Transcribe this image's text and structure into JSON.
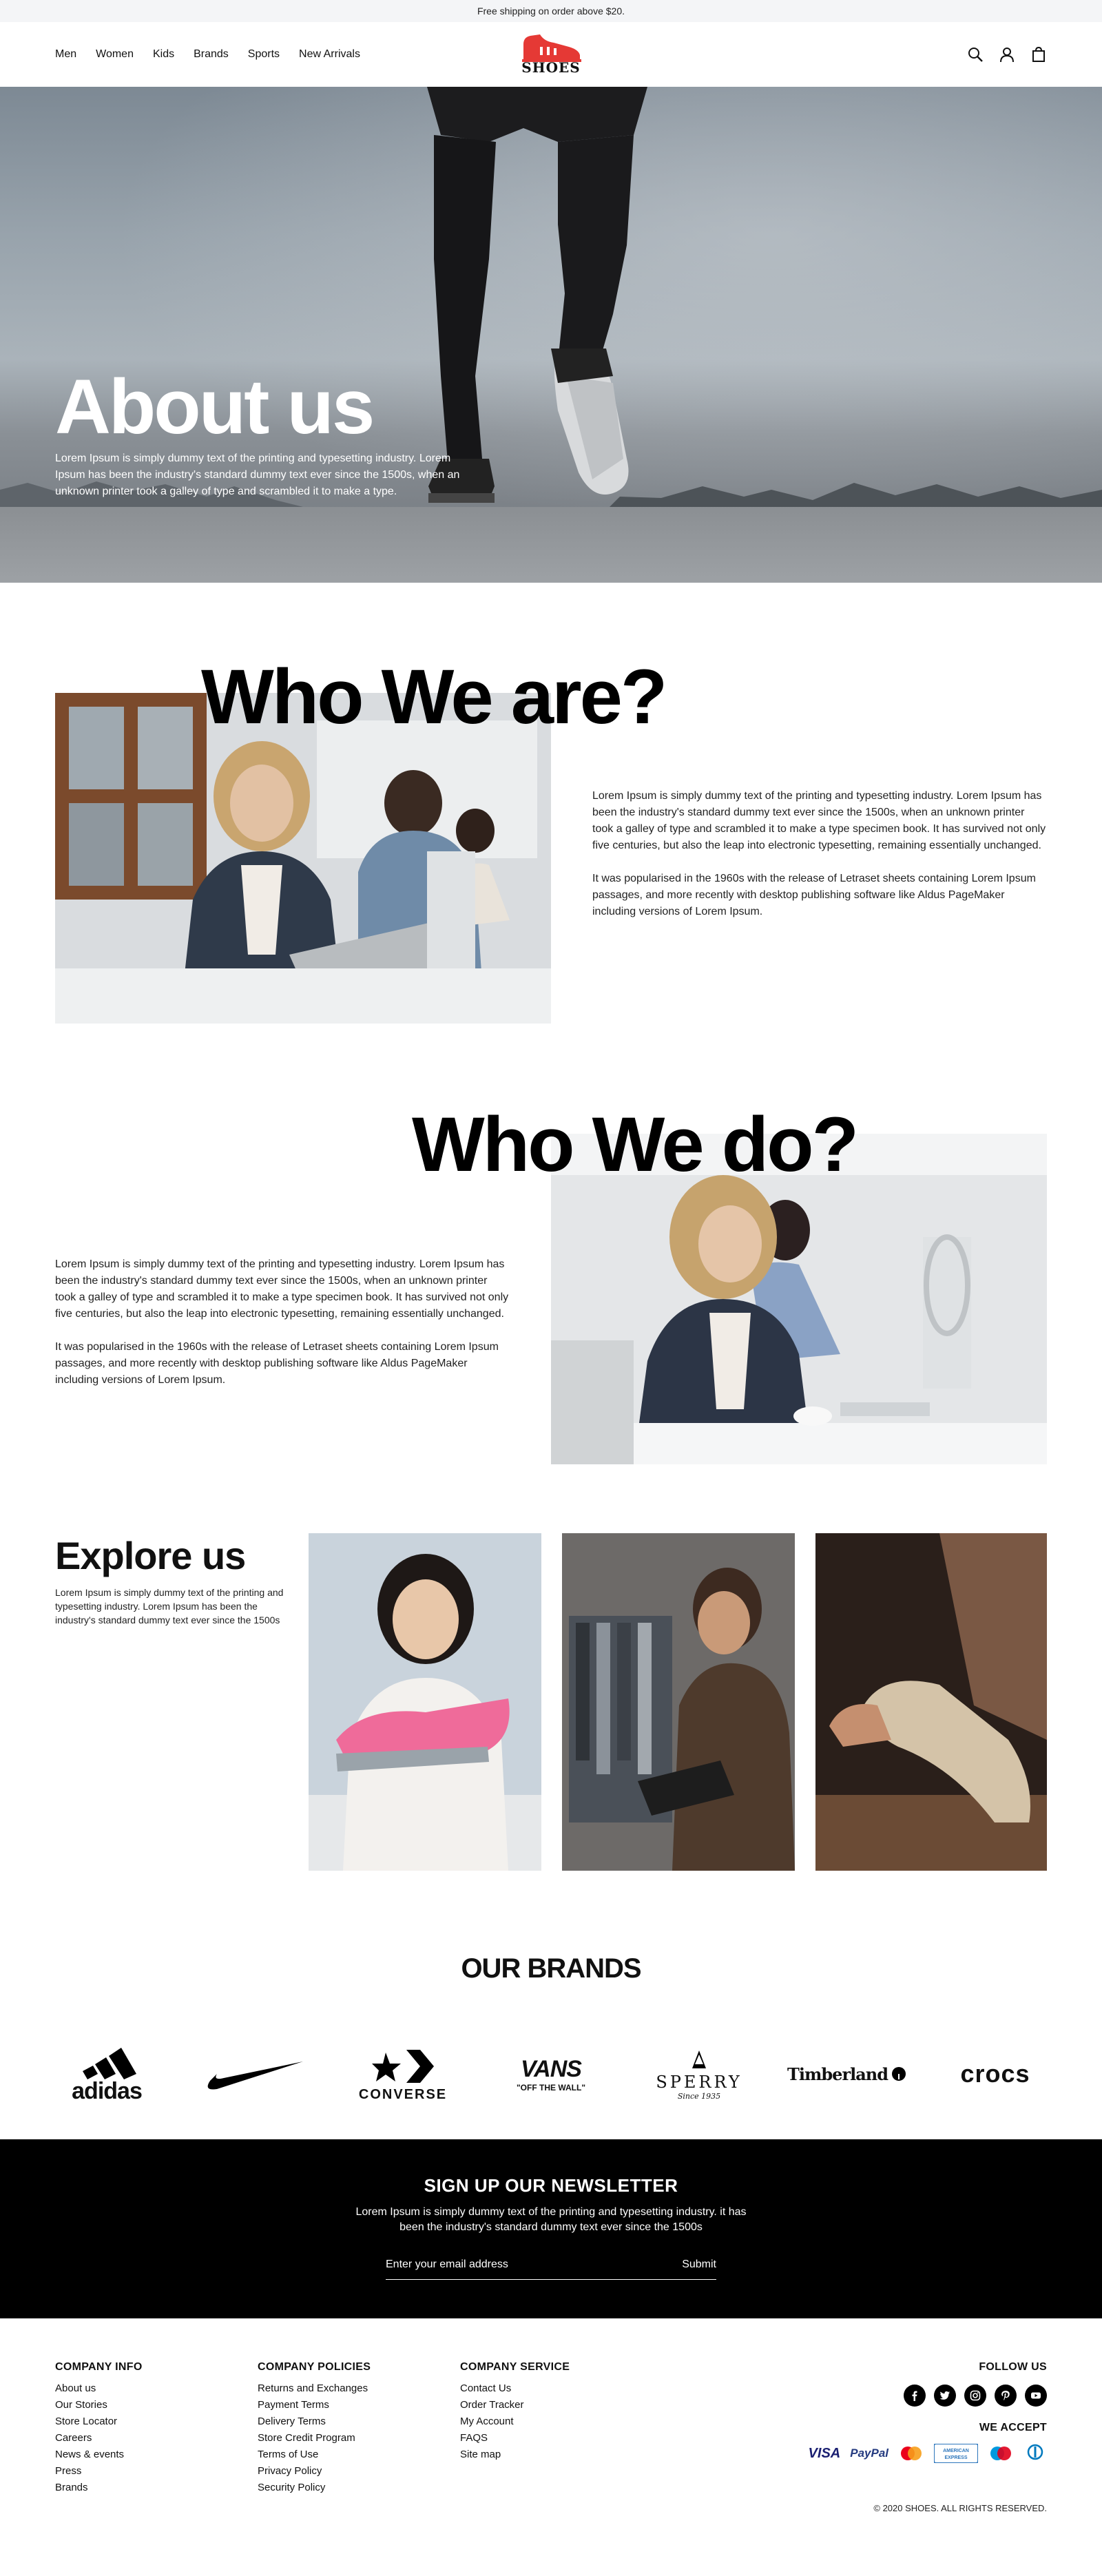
{
  "topbar": {
    "text": "Free shipping on order above $20."
  },
  "header": {
    "nav": [
      "Men",
      "Women",
      "Kids",
      "Brands",
      "Sports",
      "New Arrivals"
    ],
    "logo_text": "SHOES",
    "brand_color": "#e53935"
  },
  "hero": {
    "title": "About us",
    "text": "Lorem Ipsum is simply dummy text of the printing and typesetting industry. Lorem Ipsum has been the industry's standard dummy text ever since the 1500s, when an unknown printer took a galley of type and scrambled it to make a type."
  },
  "who_are": {
    "title": "Who We are?",
    "p1": "Lorem Ipsum is simply dummy text of the printing and typesetting industry. Lorem Ipsum has been the industry's standard dummy text ever since the 1500s, when an unknown printer took a galley of type and scrambled it to make a type specimen book. It has survived not only five centuries, but also the leap into electronic typesetting, remaining essentially unchanged.",
    "p2": "It was popularised in the 1960s with the release of Letraset sheets containing Lorem Ipsum passages, and more recently with desktop publishing software like Aldus PageMaker including versions of Lorem Ipsum."
  },
  "who_do": {
    "title": "Who We do?",
    "p1": "Lorem Ipsum is simply dummy text of the printing and typesetting industry. Lorem Ipsum has been the industry's standard dummy text ever since the 1500s, when an unknown printer took a galley of type and scrambled it to make a type specimen book. It has survived not only five centuries, but also the leap into electronic typesetting, remaining essentially unchanged.",
    "p2": "It was popularised in the 1960s with the release of Letraset sheets containing Lorem Ipsum passages, and more recently with desktop publishing software like Aldus PageMaker including versions of Lorem Ipsum."
  },
  "explore": {
    "title": "Explore us",
    "text": "Lorem Ipsum is simply dummy text of the printing and typesetting industry. Lorem Ipsum has been the industry's standard dummy text ever since the 1500s"
  },
  "brands": {
    "title": "OUR BRANDS",
    "items": [
      "adidas",
      "nike",
      "CONVERSE",
      "VANS",
      "SPERRY",
      "Timberland",
      "crocs"
    ],
    "vans_tagline": "\"OFF THE WALL\"",
    "sperry_tagline": "Since 1935"
  },
  "newsletter": {
    "title": "SIGN UP OUR NEWSLETTER",
    "text": "Lorem Ipsum is simply dummy text of the printing and typesetting industry. it has been the industry's standard dummy text ever since the 1500s",
    "placeholder": "Enter your email address",
    "submit": "Submit"
  },
  "footer": {
    "company_info": {
      "title": "COMPANY INFO",
      "links": [
        "About us",
        "Our Stories",
        "Store Locator",
        "Careers",
        "News & events",
        "Press",
        "Brands"
      ]
    },
    "company_policies": {
      "title": "COMPANY POLICIES",
      "links": [
        "Returns and Exchanges",
        "Payment Terms",
        "Delivery Terms",
        "Store Credit Program",
        "Terms of Use",
        "Privacy Policy",
        "Security Policy"
      ]
    },
    "company_service": {
      "title": "COMPANY SERVICE",
      "links": [
        "Contact Us",
        "Order Tracker",
        "My Account",
        "FAQS",
        "Site map"
      ]
    },
    "follow_title": "FOLLOW US",
    "social_icons": [
      "facebook-icon",
      "twitter-icon",
      "instagram-icon",
      "pinterest-icon",
      "youtube-icon"
    ],
    "accept_title": "WE ACCEPT",
    "payments": [
      "VISA",
      "PayPal",
      "mastercard",
      "AMERICAN EXPRESS",
      "maestro",
      "diners club"
    ],
    "copyright": "© 2020 SHOES. ALL RIGHTS RESERVED."
  }
}
